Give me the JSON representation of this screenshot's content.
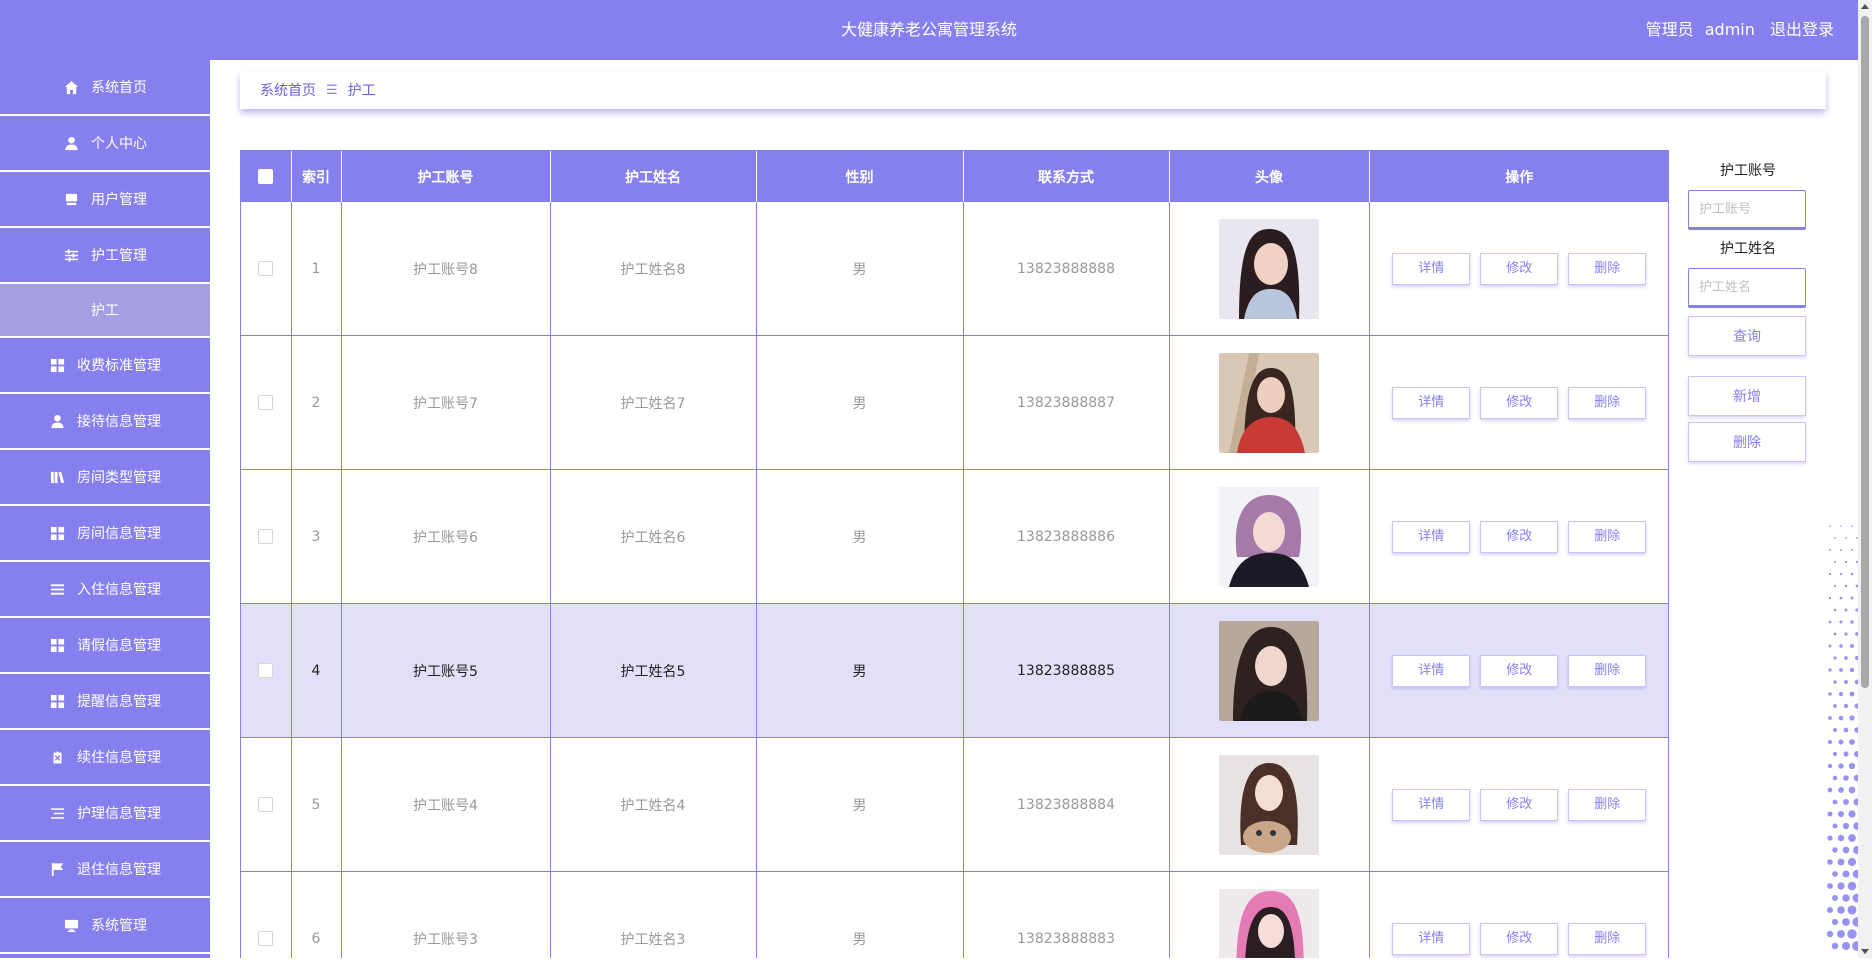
{
  "header": {
    "title": "大健康养老公寓管理系统",
    "role": "管理员",
    "username": "admin",
    "logout": "退出登录"
  },
  "sidebar": {
    "items": [
      {
        "label": "系统首页",
        "icon": "home-icon"
      },
      {
        "label": "个人中心",
        "icon": "user-icon"
      },
      {
        "label": "用户管理",
        "icon": "monitor-icon"
      },
      {
        "label": "护工管理",
        "icon": "sliders-icon"
      },
      {
        "label": "护工",
        "icon": "",
        "sub": true
      },
      {
        "label": "收费标准管理",
        "icon": "grid-icon"
      },
      {
        "label": "接待信息管理",
        "icon": "user-icon"
      },
      {
        "label": "房间类型管理",
        "icon": "book-icon"
      },
      {
        "label": "房间信息管理",
        "icon": "grid-icon"
      },
      {
        "label": "入住信息管理",
        "icon": "list-icon"
      },
      {
        "label": "请假信息管理",
        "icon": "grid-icon"
      },
      {
        "label": "提醒信息管理",
        "icon": "grid-icon"
      },
      {
        "label": "续住信息管理",
        "icon": "clipboard-icon"
      },
      {
        "label": "护理信息管理",
        "icon": "list-icon"
      },
      {
        "label": "退住信息管理",
        "icon": "flag-icon"
      },
      {
        "label": "系统管理",
        "icon": "monitor-icon"
      }
    ]
  },
  "breadcrumb": {
    "home": "系统首页",
    "separator": "☰",
    "current": "护工"
  },
  "table": {
    "columns": [
      "",
      "索引",
      "护工账号",
      "护工姓名",
      "性别",
      "联系方式",
      "头像",
      "操作"
    ],
    "rows": [
      {
        "index": "1",
        "account": "护工账号8",
        "name": "护工姓名8",
        "gender": "男",
        "phone": "13823888888"
      },
      {
        "index": "2",
        "account": "护工账号7",
        "name": "护工姓名7",
        "gender": "男",
        "phone": "13823888887"
      },
      {
        "index": "3",
        "account": "护工账号6",
        "name": "护工姓名6",
        "gender": "男",
        "phone": "13823888886"
      },
      {
        "index": "4",
        "account": "护工账号5",
        "name": "护工姓名5",
        "gender": "男",
        "phone": "13823888885"
      },
      {
        "index": "5",
        "account": "护工账号4",
        "name": "护工姓名4",
        "gender": "男",
        "phone": "13823888884"
      },
      {
        "index": "6",
        "account": "护工账号3",
        "name": "护工姓名3",
        "gender": "男",
        "phone": "13823888883"
      }
    ],
    "actions": {
      "detail": "详情",
      "edit": "修改",
      "delete": "删除"
    }
  },
  "search": {
    "account_label": "护工账号",
    "account_placeholder": "护工账号",
    "name_label": "护工姓名",
    "name_placeholder": "护工姓名",
    "query": "查询",
    "add": "新增",
    "delete": "删除"
  },
  "colors": {
    "accent": "#8680ee",
    "row_highlight": "#e2e0f9",
    "submenu_bg": "#a39fe0"
  }
}
